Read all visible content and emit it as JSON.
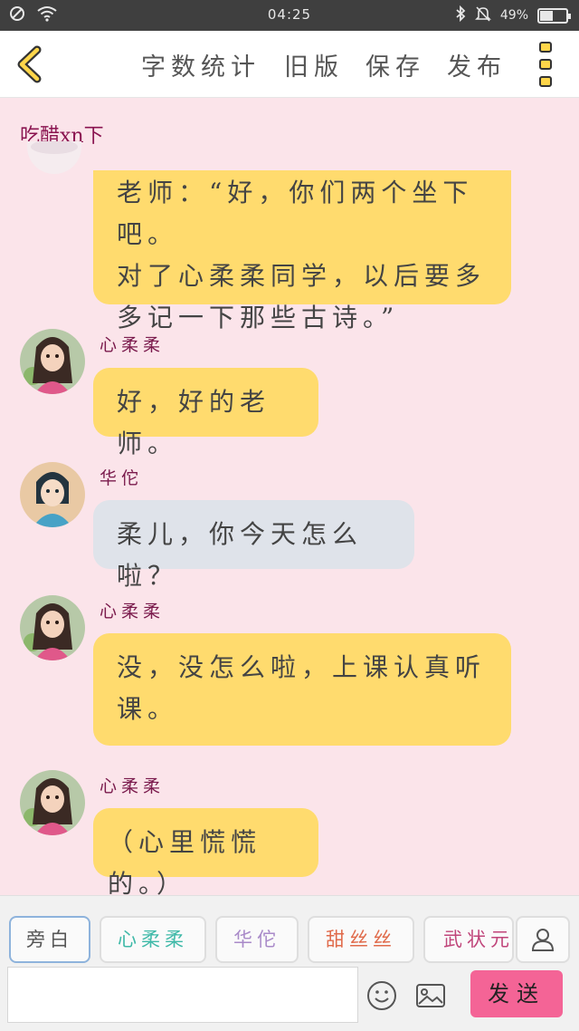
{
  "status_bar": {
    "time": "04:25",
    "battery": "49%",
    "battery_level": 0.49,
    "icons": [
      "no-sim-icon",
      "wifi-icon",
      "bluetooth-icon",
      "silent-bell-icon",
      "battery-icon"
    ]
  },
  "toolbar": {
    "back_icon": "chevron-left-icon",
    "word_count_label": "字数统计",
    "old_version_label": "旧版",
    "save_label": "保存",
    "publish_label": "发布",
    "menu_icon": "more-vertical-icon",
    "accent_color": "#ffd64a"
  },
  "chat": {
    "story_title": "吃醋xn下",
    "messages": [
      {
        "speaker": "",
        "text_lines": [
          "老师：“好，你们两个坐下吧。",
          "对了心柔柔同学，以后要多",
          "多记一下那些古诗。”"
        ],
        "bubble_color": "#ffdb6e"
      },
      {
        "speaker": "心柔柔",
        "text_lines": [
          "好，好的老师。"
        ],
        "bubble_color": "#ffdb6e"
      },
      {
        "speaker": "华佗",
        "text_lines": [
          "柔儿，你今天怎么啦？"
        ],
        "bubble_color": "#dfe3ea"
      },
      {
        "speaker": "心柔柔",
        "text_lines": [
          "没，没怎么啦，上课认真听",
          "课。"
        ],
        "bubble_color": "#ffdb6e"
      },
      {
        "speaker": "心柔柔",
        "text_lines": [
          "（心里慌慌的。）"
        ],
        "bubble_color": "#ffdb6e"
      }
    ]
  },
  "roles": [
    {
      "label": "旁白",
      "color": "#555555"
    },
    {
      "label": "心柔柔",
      "color": "#3fb9a8"
    },
    {
      "label": "华佗",
      "color": "#a98ac9"
    },
    {
      "label": "甜丝丝",
      "color": "#e06a4a"
    },
    {
      "label": "武状元",
      "color": "#c0457a"
    }
  ],
  "input": {
    "value": "",
    "placeholder": "",
    "emoji_icon": "smiley-icon",
    "image_icon": "image-icon",
    "contact_icon": "person-icon",
    "send_label": "发送",
    "send_color": "#f46496"
  }
}
